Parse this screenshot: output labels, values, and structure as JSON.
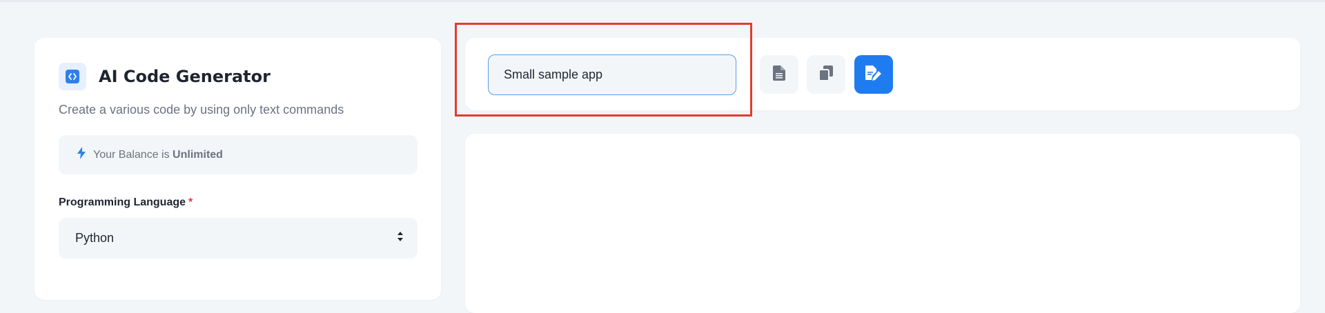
{
  "app": {
    "title": "AI Code Generator",
    "subtitle": "Create a various code by using only text commands"
  },
  "balance": {
    "prefix": "Your Balance is ",
    "value": "Unlimited",
    "icon": "lightning-icon"
  },
  "form": {
    "language_label": "Programming Language",
    "required_mark": "*",
    "language_selected": "Python"
  },
  "toolbar": {
    "prompt_value": "Small sample app",
    "buttons": [
      "document-icon",
      "copy-icon",
      "edit-document-icon"
    ]
  },
  "colors": {
    "accent": "#1f7cf0",
    "highlight": "#e33b2e",
    "required": "#e53935"
  }
}
